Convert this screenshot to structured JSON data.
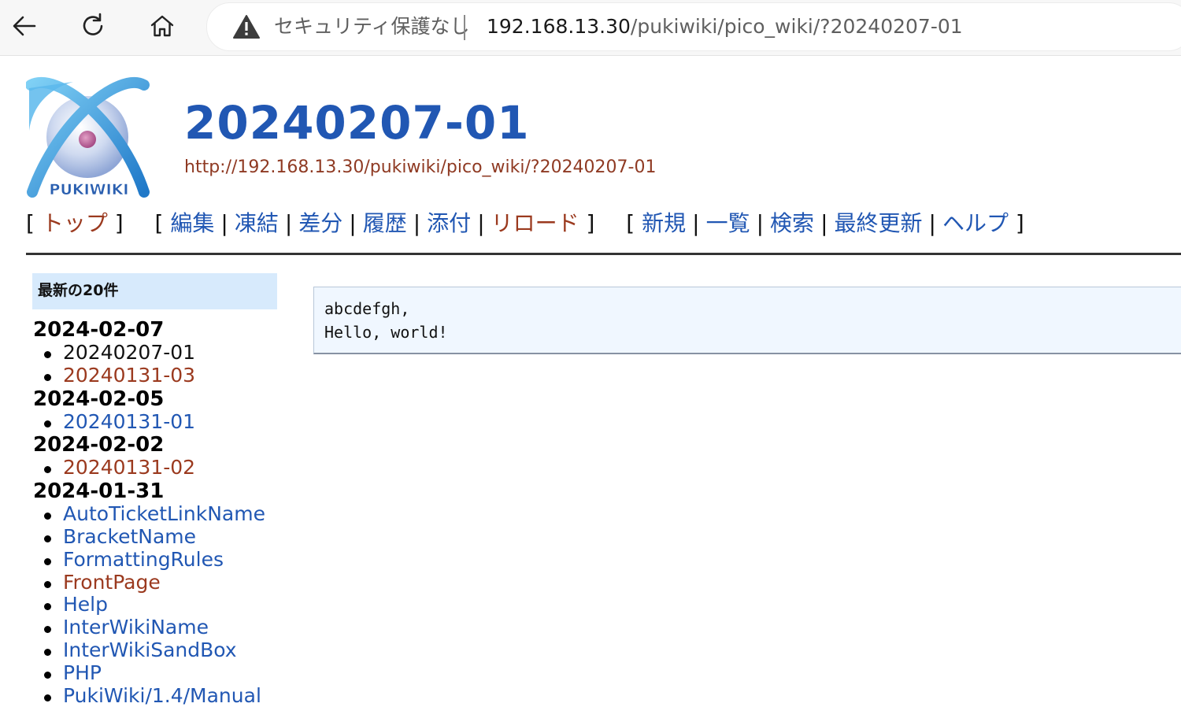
{
  "browser": {
    "security_label": "セキュリティ保護なし",
    "url_host": "192.168.13.30",
    "url_path": "/pukiwiki/pico_wiki/?20240207-01"
  },
  "logo": {
    "text": "PUKIWIKI"
  },
  "page": {
    "title": "20240207-01",
    "url": "http://192.168.13.30/pukiwiki/pico_wiki/?20240207-01"
  },
  "nav": {
    "top": "トップ",
    "edit": "編集",
    "freeze": "凍結",
    "diff": "差分",
    "history": "履歴",
    "attach": "添付",
    "reload": "リロード",
    "new": "新規",
    "list": "一覧",
    "search": "検索",
    "recent": "最終更新",
    "help": "ヘルプ"
  },
  "sidebar": {
    "heading": "最新の20件",
    "groups": [
      {
        "date": "2024-02-07",
        "items": [
          "20240207-01",
          "20240131-03"
        ]
      },
      {
        "date": "2024-02-05",
        "items": [
          "20240131-01"
        ]
      },
      {
        "date": "2024-02-02",
        "items": [
          "20240131-02"
        ]
      },
      {
        "date": "2024-01-31",
        "items": [
          "AutoTicketLinkName",
          "BracketName",
          "FormattingRules",
          "FrontPage",
          "Help",
          "InterWikiName",
          "InterWikiSandBox",
          "PHP",
          "PukiWiki/1.4/Manual"
        ]
      }
    ]
  },
  "content": {
    "lines": [
      "abcdefgh,",
      "Hello, world!"
    ]
  },
  "colors": {
    "link": "#2157b3",
    "visited_link": "#9b3a1f",
    "sidebar_heading_bg": "#d7eafc",
    "pre_bg": "#f0f7ff"
  }
}
